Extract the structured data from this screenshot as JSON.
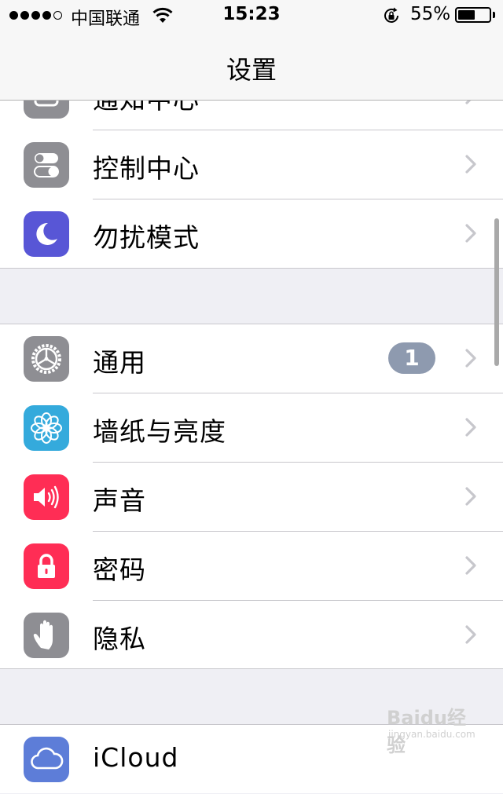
{
  "status_bar": {
    "carrier": "中国联通",
    "time": "15:23",
    "battery_percent_label": "55%",
    "battery_level": 0.55,
    "signal_bars_filled": 4,
    "signal_bars_total": 5
  },
  "nav": {
    "title": "设置"
  },
  "groups": [
    {
      "items": [
        {
          "label": "通知中心",
          "icon": "notification-center-icon",
          "color": "#8e8e93"
        },
        {
          "label": "控制中心",
          "icon": "control-center-icon",
          "color": "#8e8e93"
        },
        {
          "label": "勿扰模式",
          "icon": "moon-icon",
          "color": "#5856d6"
        }
      ]
    },
    {
      "items": [
        {
          "label": "通用",
          "icon": "gear-icon",
          "color": "#8e8e93",
          "badge": "1"
        },
        {
          "label": "墙纸与亮度",
          "icon": "flower-icon",
          "color": "#34aadc"
        },
        {
          "label": "声音",
          "icon": "speaker-icon",
          "color": "#ff2d55"
        },
        {
          "label": "密码",
          "icon": "lock-icon",
          "color": "#ff2d55"
        },
        {
          "label": "隐私",
          "icon": "hand-icon",
          "color": "#8e8e93"
        }
      ]
    },
    {
      "items": [
        {
          "label": "iCloud",
          "icon": "icloud-icon",
          "color": "#5d7dd8"
        }
      ]
    }
  ],
  "watermark": {
    "text": "Baidu经验",
    "sub": "jingyan.baidu.com"
  }
}
